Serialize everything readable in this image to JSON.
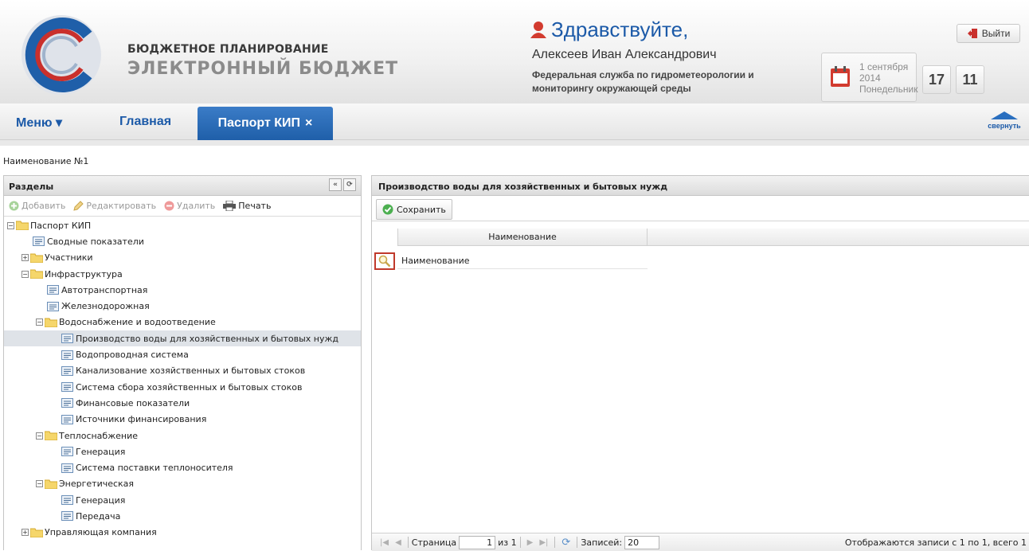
{
  "header": {
    "brand_line1": "БЮДЖЕТНОЕ ПЛАНИРОВАНИЕ",
    "brand_line2": "ЭЛЕКТРОННЫЙ БЮДЖЕТ",
    "greeting": "Здравствуйте,",
    "user_name": "Алексеев Иван Александрович",
    "organization": "Федеральная служба по гидрометеорологии и мониторингу окружающей среды",
    "exit_label": "Выйти",
    "date_day": "1 сентября",
    "date_year": "2014",
    "date_weekday": "Понедельник",
    "hours": "17",
    "minutes": "11"
  },
  "nav": {
    "menu": "Меню ▾",
    "home": "Главная",
    "active_tab": "Паспорт КИП",
    "close": "×",
    "collapse": "свернуть"
  },
  "breadcrumb": "Наименование №1",
  "left_panel": {
    "title": "Разделы",
    "toolbar": {
      "add": "Добавить",
      "edit": "Редактировать",
      "delete": "Удалить",
      "print": "Печать"
    },
    "tree": [
      {
        "label": "Паспорт КИП",
        "type": "folder",
        "expanded": true
      },
      {
        "label": "Сводные показатели",
        "type": "leaf"
      },
      {
        "label": "Участники",
        "type": "folder",
        "expanded": false
      },
      {
        "label": "Инфраструктура",
        "type": "folder",
        "expanded": true
      },
      {
        "label": "Автотранспортная",
        "type": "leaf"
      },
      {
        "label": "Железнодорожная",
        "type": "leaf"
      },
      {
        "label": "Водоснабжение и водоотведение",
        "type": "folder",
        "expanded": true
      },
      {
        "label": "Производство воды для хозяйственных и бытовых нужд",
        "type": "leaf",
        "selected": true
      },
      {
        "label": "Водопроводная система",
        "type": "leaf"
      },
      {
        "label": "Канализование хозяйственных и бытовых стоков",
        "type": "leaf"
      },
      {
        "label": "Система сбора хозяйственных и бытовых стоков",
        "type": "leaf"
      },
      {
        "label": "Финансовые показатели",
        "type": "leaf"
      },
      {
        "label": "Источники финансирования",
        "type": "leaf"
      },
      {
        "label": "Теплоснабжение",
        "type": "folder",
        "expanded": true
      },
      {
        "label": "Генерация",
        "type": "leaf"
      },
      {
        "label": "Система поставки теплоносителя",
        "type": "leaf"
      },
      {
        "label": "Энергетическая",
        "type": "folder",
        "expanded": true
      },
      {
        "label": "Генерация",
        "type": "leaf"
      },
      {
        "label": "Передача",
        "type": "leaf"
      },
      {
        "label": "Управляющая компания",
        "type": "folder",
        "expanded": false
      }
    ]
  },
  "right_panel": {
    "title": "Производство воды для хозяйственных и бытовых нужд",
    "save_label": "Сохранить",
    "column_header": "Наименование",
    "rows": [
      {
        "name": "Наименование"
      }
    ],
    "pager": {
      "page_label": "Страница",
      "page_value": "1",
      "of_label": "из 1",
      "records_label": "Записей:",
      "records_value": "20",
      "info": "Отображаются записи с 1 по 1, всего 1"
    }
  },
  "colors": {
    "accent_blue": "#1c5aa8",
    "active_tab": "#2a6bb8",
    "highlight_red": "#c0392b"
  }
}
